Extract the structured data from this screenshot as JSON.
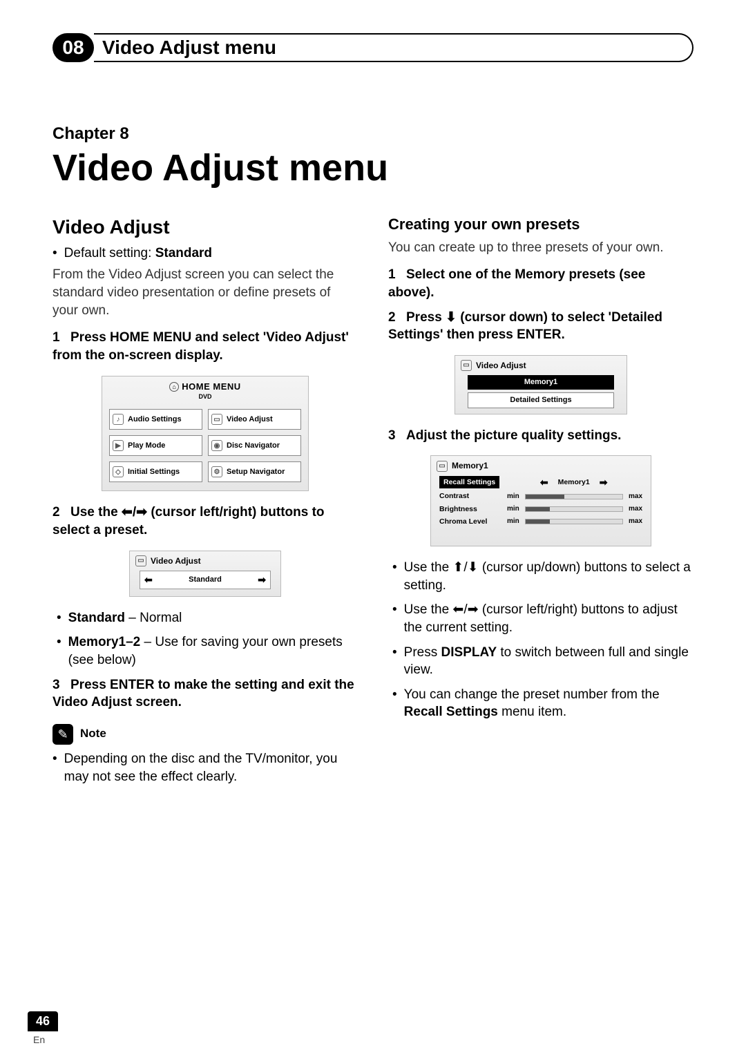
{
  "header": {
    "chapter_num": "08",
    "title": "Video Adjust menu"
  },
  "chapter": {
    "label": "Chapter 8",
    "title": "Video Adjust menu"
  },
  "left": {
    "section": "Video Adjust",
    "default_prefix": "Default setting: ",
    "default_value": "Standard",
    "intro": "From the Video Adjust screen you can select the standard video presentation or define presets of your own.",
    "step1_num": "1",
    "step1": "Press HOME MENU and select 'Video Adjust' from the on-screen display.",
    "home_menu": {
      "title": "HOME MENU",
      "sub": "DVD",
      "cells": [
        "Audio Settings",
        "Video Adjust",
        "Play Mode",
        "Disc Navigator",
        "Initial Settings",
        "Setup Navigator"
      ]
    },
    "step2_num": "2",
    "step2_a": "Use the ",
    "step2_b": " (cursor left/right) buttons to select a preset.",
    "va_box": {
      "title": "Video Adjust",
      "value": "Standard"
    },
    "presets": {
      "std_label": "Standard",
      "std_desc": " – Normal",
      "mem_label": "Memory1–2",
      "mem_desc": " – Use for saving your own presets (see below)"
    },
    "step3_num": "3",
    "step3": "Press ENTER to make the setting and exit the Video Adjust screen.",
    "note_label": "Note",
    "note_text": "Depending on the disc and the TV/monitor, you may not see the effect clearly."
  },
  "right": {
    "section": "Creating your own presets",
    "intro": "You can create up to three presets of your own.",
    "step1_num": "1",
    "step1": "Select one of the Memory presets (see above).",
    "step2_num": "2",
    "step2_a": "Press ",
    "step2_b": " (cursor down) to select 'Detailed Settings' then press ENTER.",
    "va2": {
      "title": "Video Adjust",
      "row1": "Memory1",
      "row2": "Detailed Settings"
    },
    "step3_num": "3",
    "step3": "Adjust the picture quality settings.",
    "mem": {
      "title": "Memory1",
      "recall": "Recall Settings",
      "sel": "Memory1",
      "rows": [
        "Contrast",
        "Brightness",
        "Chroma Level"
      ],
      "min": "min",
      "max": "max"
    },
    "tips": {
      "t1_a": "Use the ",
      "t1_b": " (cursor up/down) buttons to select a setting.",
      "t2_a": "Use the ",
      "t2_b": " (cursor left/right) buttons to adjust the current setting.",
      "t3_a": "Press ",
      "t3_bold": "DISPLAY",
      "t3_b": " to switch between full and single view.",
      "t4_a": "You can change the preset number from the ",
      "t4_bold": "Recall Settings",
      "t4_b": " menu item."
    }
  },
  "footer": {
    "page": "46",
    "lang": "En"
  },
  "glyphs": {
    "left": "⬅",
    "right": "➡",
    "up": "⬆",
    "down": "⬇",
    "slash": "/",
    "pencil": "✎"
  }
}
